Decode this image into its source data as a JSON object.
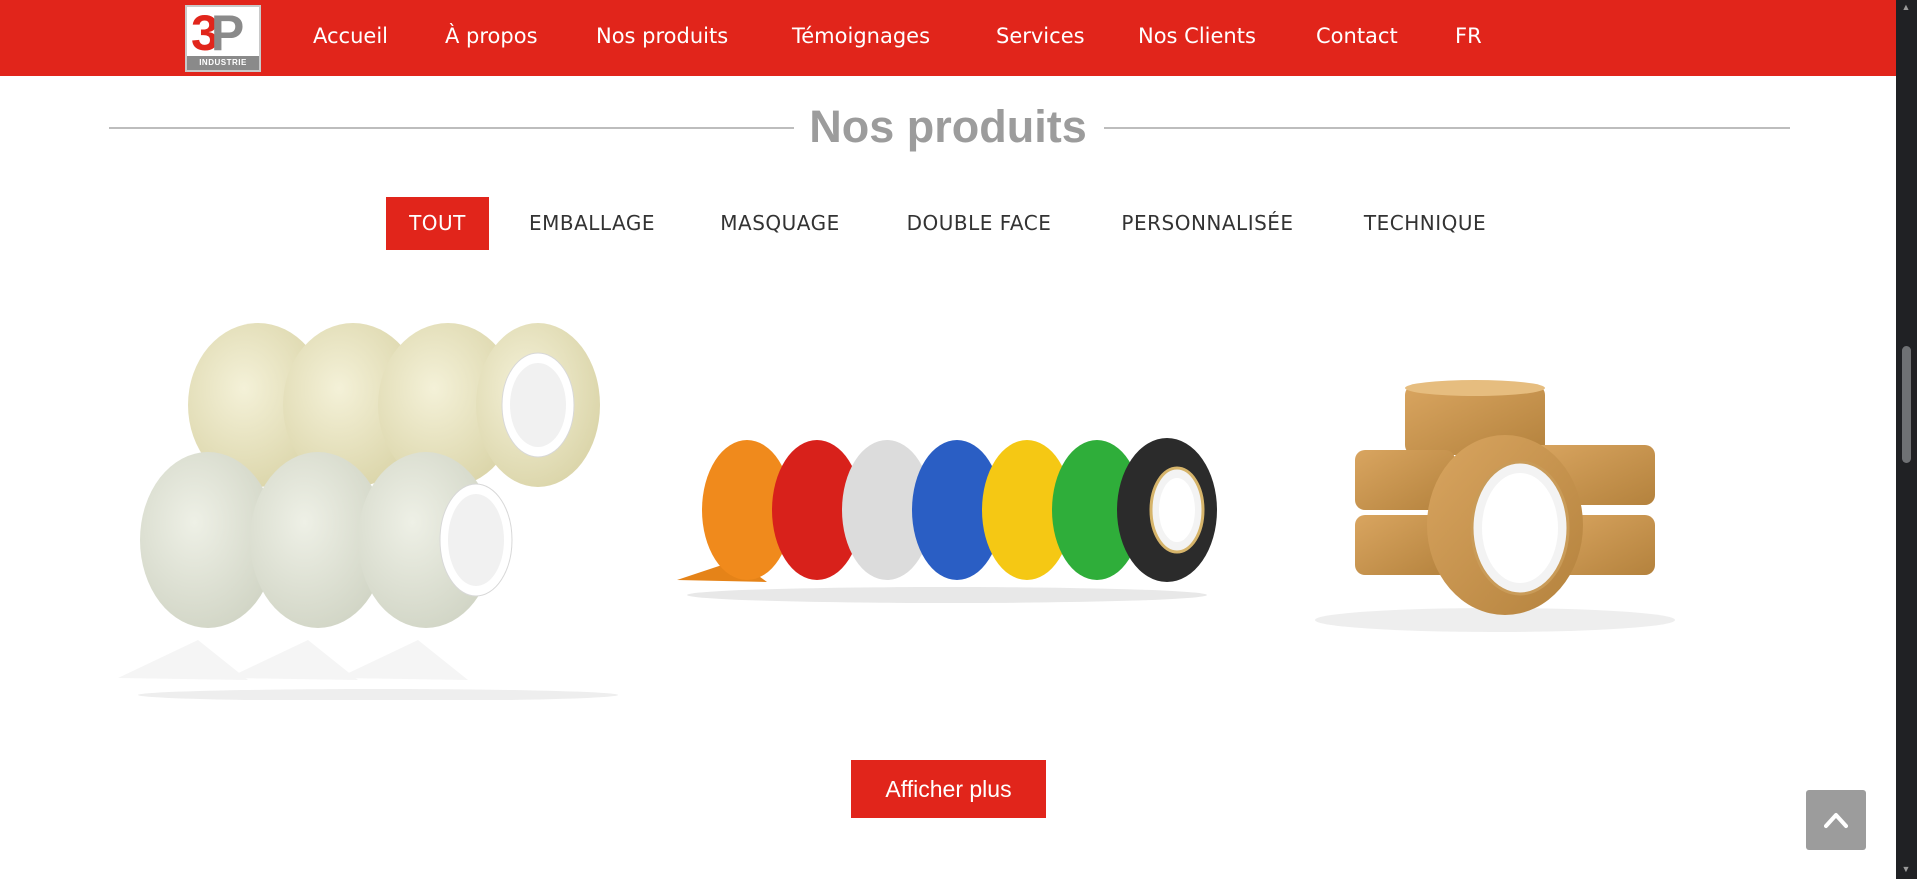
{
  "brand": {
    "logo_mark": "3P",
    "logo_tag": "INDUSTRIE"
  },
  "nav": {
    "items": [
      "Accueil",
      "À propos",
      "Nos produits",
      "Témoignages",
      "Services",
      "Nos Clients",
      "Contact",
      "FR"
    ]
  },
  "section": {
    "title": "Nos produits"
  },
  "filters": {
    "items": [
      "TOUT",
      "EMBALLAGE",
      "MASQUAGE",
      "DOUBLE FACE",
      "PERSONNALISÉE",
      "TECHNIQUE"
    ],
    "active": "TOUT"
  },
  "products": [
    {
      "icon": "clear-tape-rolls-image"
    },
    {
      "icon": "colored-tape-rolls-image"
    },
    {
      "icon": "brown-tape-rolls-image"
    }
  ],
  "actions": {
    "more_label": "Afficher plus"
  },
  "colors": {
    "brand_red": "#e1251b",
    "heading_gray": "#9c9c9c",
    "button_gray": "#9c9c9c"
  }
}
